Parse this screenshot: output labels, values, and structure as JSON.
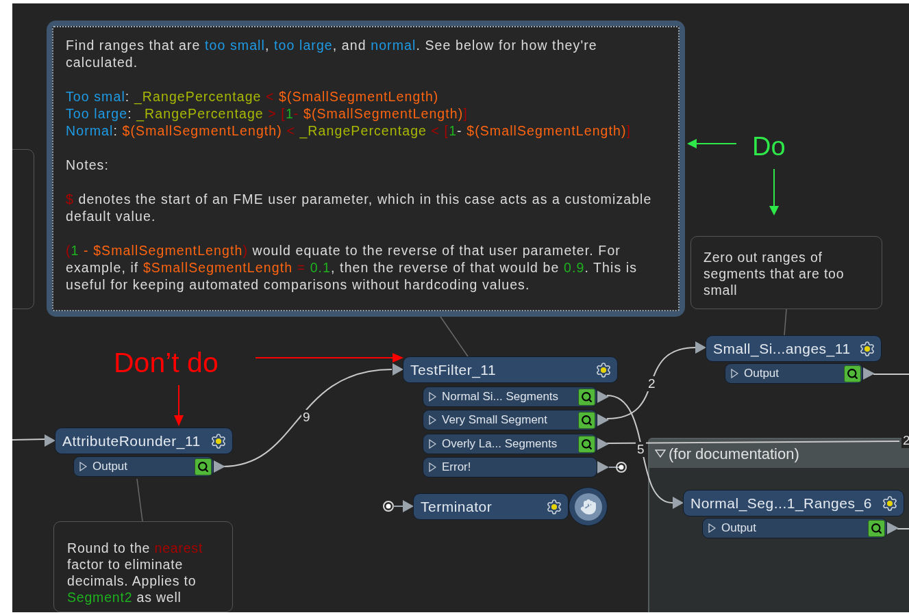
{
  "main_note": {
    "paragraphs": [
      {
        "lines": [
          [
            {
              "kind": "plain",
              "text": "Find ranges that are "
            },
            {
              "kind": "keyword",
              "text": "too small"
            },
            {
              "kind": "plain",
              "text": ", "
            },
            {
              "kind": "keyword",
              "text": "too large"
            },
            {
              "kind": "plain",
              "text": ", and "
            },
            {
              "kind": "keyword",
              "text": "normal"
            },
            {
              "kind": "plain",
              "text": ". See below for how they're calculated."
            }
          ]
        ]
      },
      {
        "lines": [
          [
            {
              "kind": "keyword",
              "text": "Too smal"
            },
            {
              "kind": "plain",
              "text": ": "
            },
            {
              "kind": "attribute",
              "text": "_RangePercentage"
            },
            {
              "kind": "operator",
              "text": " < "
            },
            {
              "kind": "parameter",
              "text": "$(SmallSegmentLength)"
            }
          ],
          [
            {
              "kind": "keyword",
              "text": "Too large"
            },
            {
              "kind": "plain",
              "text": ": "
            },
            {
              "kind": "attribute",
              "text": "_RangePercentage"
            },
            {
              "kind": "operator",
              "text": " > ["
            },
            {
              "kind": "number",
              "text": "1"
            },
            {
              "kind": "operator",
              "text": "- "
            },
            {
              "kind": "parameter",
              "text": "$(SmallSegmentLength)"
            },
            {
              "kind": "operator",
              "text": "]"
            }
          ],
          [
            {
              "kind": "keyword",
              "text": "Normal"
            },
            {
              "kind": "plain",
              "text": ": "
            },
            {
              "kind": "parameter",
              "text": "$(SmallSegmentLength)"
            },
            {
              "kind": "operator",
              "text": " < "
            },
            {
              "kind": "attribute",
              "text": "_RangePercentage"
            },
            {
              "kind": "operator",
              "text": " < ["
            },
            {
              "kind": "number",
              "text": "1"
            },
            {
              "kind": "plain",
              "text": "- "
            },
            {
              "kind": "parameter",
              "text": "$(SmallSegmentLength)"
            },
            {
              "kind": "operator",
              "text": "]"
            }
          ]
        ]
      },
      {
        "lines": [
          [
            {
              "kind": "plain",
              "text": "Notes:"
            }
          ]
        ]
      },
      {
        "lines": [
          [
            {
              "kind": "operator",
              "text": "$"
            },
            {
              "kind": "plain",
              "text": " denotes the start of an FME user parameter, which in this case acts as a customizable default value."
            }
          ]
        ]
      },
      {
        "lines": [
          [
            {
              "kind": "operator",
              "text": "("
            },
            {
              "kind": "number",
              "text": "1"
            },
            {
              "kind": "parameter",
              "text": " - $SmallSegmentLength"
            },
            {
              "kind": "operator",
              "text": ")"
            },
            {
              "kind": "plain",
              "text": " would equate to the reverse of that user parameter. For example, if "
            },
            {
              "kind": "parameter",
              "text": "$SmallSegmentLength"
            },
            {
              "kind": "operator",
              "text": " = "
            },
            {
              "kind": "number",
              "text": "0.1"
            },
            {
              "kind": "plain",
              "text": ", then the reverse of that would be "
            },
            {
              "kind": "number",
              "text": "0.9"
            },
            {
              "kind": "plain",
              "text": ". This is useful for keeping automated comparisons without hardcoding values."
            }
          ]
        ]
      }
    ]
  },
  "notes": [
    {
      "segments": [
        {
          "kind": "plain",
          "text": "Zero out ranges of segments that are too small"
        }
      ]
    },
    {
      "segments": [
        {
          "kind": "plain",
          "text": "Round to the "
        },
        {
          "kind": "operator",
          "text": "nearest"
        },
        {
          "kind": "plain",
          "text": " factor to eliminate decimals. Applies to "
        },
        {
          "kind": "number",
          "text": "Segment2"
        },
        {
          "kind": "plain",
          "text": " as well"
        }
      ]
    }
  ],
  "markers": [
    {
      "text": "Do",
      "color": "#2ee84a"
    },
    {
      "text": "Don’t do",
      "color": "#ff0000"
    }
  ],
  "bookmark": {
    "title": "(for documentation)",
    "expanded": true
  },
  "transformers": [
    {
      "name": "AttributeRounder_11",
      "kind": "transformer",
      "ports": [
        {
          "name": "Output",
          "kind": "inspect"
        }
      ]
    },
    {
      "name": "TestFilter_11",
      "kind": "transformer",
      "ports": [
        {
          "name": "Normal Si... Segments",
          "kind": "inspect"
        },
        {
          "name": "Very Small Segment",
          "kind": "inspect"
        },
        {
          "name": "Overly La... Segments",
          "kind": "inspect"
        },
        {
          "name": "Error!",
          "kind": "unconnected"
        }
      ]
    },
    {
      "name": "Terminator",
      "kind": "terminator"
    },
    {
      "name": "Small_Si...anges_11",
      "kind": "transformer",
      "ports": [
        {
          "name": "Output",
          "kind": "inspect"
        }
      ]
    },
    {
      "name": "Normal_Seg...1_Ranges_6",
      "kind": "transformer",
      "ports": [
        {
          "name": "Output",
          "kind": "inspect"
        }
      ]
    }
  ],
  "connections": [
    {
      "count": "9"
    },
    {
      "count": "2"
    },
    {
      "count": "5"
    },
    {
      "count": "2"
    }
  ]
}
